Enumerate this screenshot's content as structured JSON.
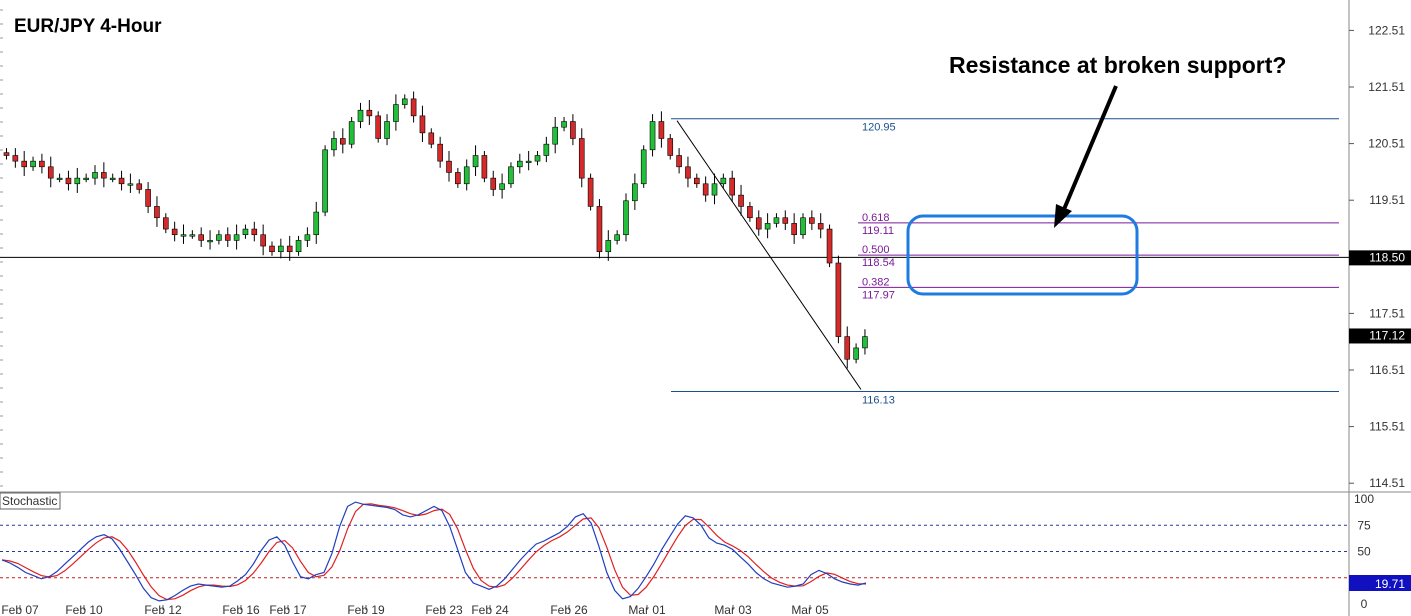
{
  "chart_data": {
    "type": "candlestick",
    "title": "EUR/JPY 4-Hour",
    "price_axis": {
      "ticks": [
        "122.51",
        "121.51",
        "120.51",
        "119.51",
        "118.51",
        "117.51",
        "116.51",
        "115.51",
        "114.51"
      ],
      "range": [
        114.3,
        122.9
      ]
    },
    "time_axis": {
      "ticks": [
        "Feb 07",
        "Feb 10",
        "Feb 12",
        "Feb 16",
        "Feb 17",
        "Feb 19",
        "Feb 23",
        "Feb 24",
        "Feb 26",
        "Mar 01",
        "Mar 03",
        "Mar 05"
      ]
    },
    "support_line": {
      "value": 118.5,
      "label": "118.50"
    },
    "last_price": {
      "value": 117.12,
      "label": "117.12"
    },
    "fibonacci": {
      "high": {
        "value": 120.95,
        "label": "120.95"
      },
      "low": {
        "value": 116.13,
        "label": "116.13"
      },
      "levels": [
        {
          "ratio": "0.618",
          "value": 119.11,
          "label": "119.11"
        },
        {
          "ratio": "0.500",
          "value": 118.54,
          "label": "118.54"
        },
        {
          "ratio": "0.382",
          "value": 117.97,
          "label": "117.97"
        }
      ]
    },
    "annotation": {
      "text": "Resistance at broken support?"
    },
    "candles_close": [
      120.3,
      120.2,
      120.1,
      120.2,
      120.1,
      119.9,
      119.9,
      119.8,
      119.9,
      119.9,
      120.0,
      119.9,
      119.9,
      119.8,
      119.8,
      119.7,
      119.4,
      119.2,
      119.0,
      118.9,
      118.9,
      118.9,
      118.8,
      118.8,
      118.9,
      118.8,
      118.9,
      119.0,
      118.9,
      118.7,
      118.6,
      118.7,
      118.6,
      118.8,
      118.9,
      119.3,
      120.4,
      120.6,
      120.5,
      120.9,
      121.1,
      121.0,
      120.6,
      120.9,
      121.2,
      121.3,
      121.0,
      120.7,
      120.5,
      120.2,
      120.0,
      119.8,
      120.1,
      120.3,
      119.9,
      119.7,
      119.8,
      120.1,
      120.2,
      120.2,
      120.3,
      120.5,
      120.8,
      120.9,
      120.6,
      119.9,
      119.4,
      118.6,
      118.8,
      118.9,
      119.5,
      119.8,
      120.4,
      120.9,
      120.6,
      120.3,
      120.1,
      119.9,
      119.8,
      119.6,
      119.8,
      119.9,
      119.6,
      119.4,
      119.2,
      119.0,
      119.1,
      119.2,
      119.1,
      118.9,
      119.2,
      119.1,
      119.0,
      118.4,
      117.1,
      116.7,
      116.9,
      117.1
    ],
    "stochastic": {
      "label": "Stochastic",
      "axis_ticks": [
        "100",
        "75",
        "50",
        "0"
      ],
      "levels": [
        75,
        50,
        25
      ],
      "value_label": "19.71",
      "k": [
        42,
        39,
        35,
        30,
        27,
        24,
        26,
        31,
        38,
        45,
        52,
        59,
        64,
        66,
        62,
        52,
        40,
        28,
        15,
        6,
        3,
        4,
        8,
        13,
        17,
        19,
        18,
        17,
        16,
        17,
        22,
        28,
        38,
        51,
        61,
        64,
        56,
        40,
        26,
        24,
        28,
        30,
        48,
        74,
        93,
        97,
        95,
        94,
        93,
        92,
        90,
        85,
        83,
        85,
        89,
        93,
        89,
        74,
        52,
        30,
        20,
        17,
        14,
        17,
        24,
        33,
        42,
        50,
        57,
        60,
        64,
        68,
        74,
        83,
        86,
        77,
        55,
        30,
        13,
        5,
        7,
        15,
        26,
        38,
        52,
        64,
        76,
        84,
        82,
        75,
        63,
        58,
        56,
        52,
        45,
        38,
        30,
        24,
        20,
        18,
        16,
        17,
        19,
        28,
        32,
        29,
        24,
        21,
        19,
        18,
        20
      ]
    }
  }
}
